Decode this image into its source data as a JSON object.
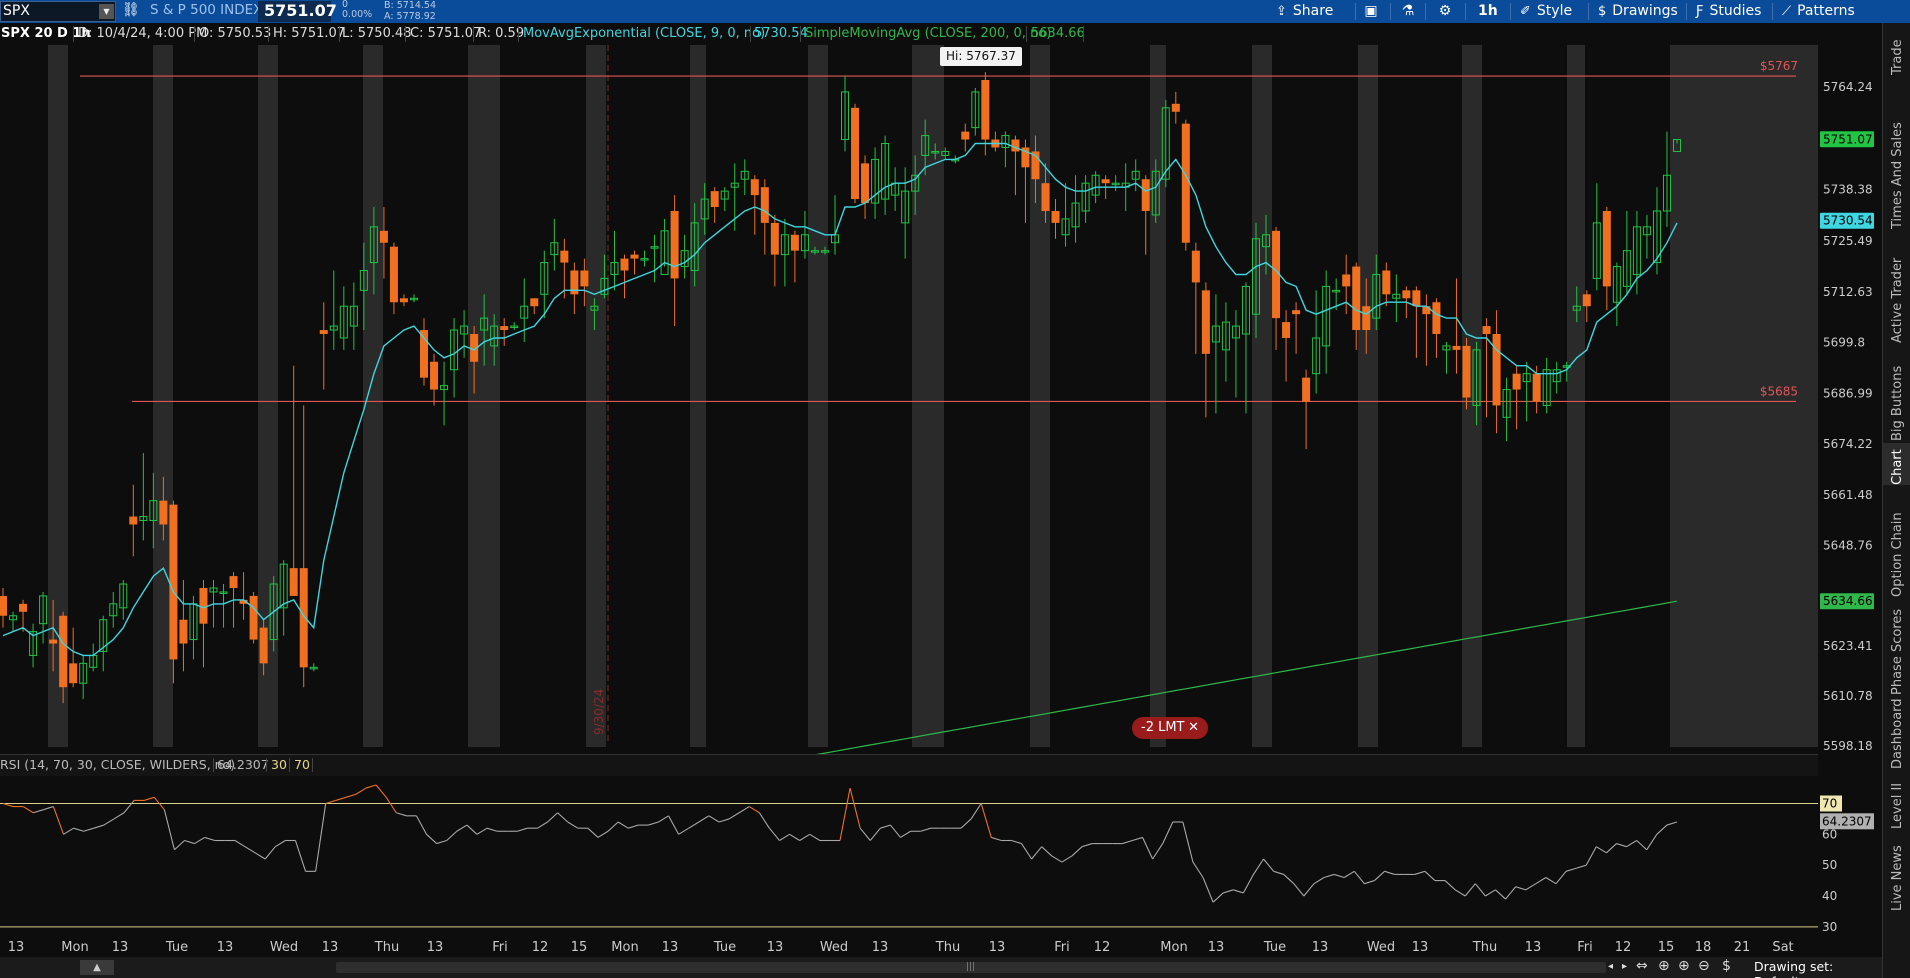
{
  "header": {
    "symbol": "SPX",
    "symbol_dropdown": "▼",
    "description": "S & P 500 INDEX",
    "last": "5751.07",
    "change": "0",
    "change_pct": "0.00%",
    "bid": "B: 5714.54",
    "ask": "A: 5778.92",
    "share": "Share",
    "timeframe": "1h",
    "style": "Style",
    "drawings": "Drawings",
    "studies": "Studies",
    "patterns": "Patterns"
  },
  "info": {
    "title": "SPX 20 D 1h",
    "date": "D: 10/4/24, 4:00 PM",
    "open": "O: 5750.53",
    "high": "H: 5751.07",
    "low": "L: 5750.48",
    "close": "C: 5751.07",
    "range": "R: 0.59",
    "ema_label": "MovAvgExponential (CLOSE, 9, 0, no)",
    "ema_value": "5730.54",
    "sma_label": "SimpleMovingAvg (CLOSE, 200, 0, no)",
    "sma_value": "5634.66"
  },
  "rsi": {
    "label": "RSI (14, 70, 30, CLOSE, WILDERS, no)",
    "value": "64.2307",
    "low": "30",
    "high": "70",
    "axis_ticks": [
      "70",
      "64.2307",
      "60",
      "50",
      "40",
      "30"
    ]
  },
  "price_axis": [
    "5764.24",
    "5751.07",
    "5738.38",
    "5730.54",
    "5725.49",
    "5712.63",
    "5699.8",
    "5686.99",
    "5674.22",
    "5661.48",
    "5648.76",
    "5634.66",
    "5623.41",
    "5610.78",
    "5598.18"
  ],
  "levels": [
    {
      "price": 5767,
      "label": "$5767"
    },
    {
      "price": 5685,
      "label": "$5685"
    }
  ],
  "hi_tooltip": "Hi: 5767.37",
  "date_marker": "9/30/24",
  "order": {
    "label": "-2 LMT",
    "close": "✕"
  },
  "time_axis": [
    "13",
    "Mon",
    "13",
    "Tue",
    "13",
    "Wed",
    "13",
    "Thu",
    "13",
    "Fri",
    "12",
    "15",
    "Mon",
    "13",
    "Tue",
    "13",
    "Wed",
    "13",
    "Thu",
    "13",
    "Fri",
    "12",
    "Mon",
    "13",
    "Tue",
    "13",
    "Wed",
    "13",
    "Thu",
    "13",
    "Fri",
    "12",
    "15",
    "18",
    "21",
    "Sat"
  ],
  "right_tabs": [
    "Trade",
    "Times And Sales",
    "Active Trader",
    "Big Buttons",
    "Chart",
    "Option Chain",
    "Phase Scores",
    "Dashboard",
    "Level II",
    "Live News"
  ],
  "footer": {
    "drawing_set": "Drawing set: Default",
    "collapse": "▲"
  },
  "colors": {
    "bg": "#0d0d0d",
    "shade": "#2a2a2a",
    "up": "#22c443",
    "down": "#f07020",
    "ema": "#3ed6e0",
    "sma": "#2fb74a",
    "level": "#e05555",
    "rsi_line": "#a8a8a8",
    "rsi_ob": "#f07020",
    "ob_line": "#d8d08a"
  },
  "chart_data": {
    "type": "candlestick",
    "symbol": "SPX",
    "interval": "1h",
    "ylim": [
      5598.18,
      5770
    ],
    "candles": [
      [
        5636,
        5631,
        5638,
        5628
      ],
      [
        5630,
        5631,
        5632,
        5627
      ],
      [
        5634,
        5632,
        5635,
        5627
      ],
      [
        5621,
        5627,
        5629,
        5618
      ],
      [
        5629,
        5636,
        5637,
        5624
      ],
      [
        5625,
        5624,
        5635,
        5617
      ],
      [
        5631,
        5613,
        5632,
        5609
      ],
      [
        5619,
        5614,
        5628,
        5613
      ],
      [
        5614,
        5619,
        5621,
        5610
      ],
      [
        5618,
        5621,
        5624,
        5617
      ],
      [
        5622,
        5630,
        5631,
        5617
      ],
      [
        5631,
        5634,
        5637,
        5628
      ],
      [
        5633,
        5639,
        5640,
        5630
      ],
      [
        5656,
        5654,
        5664,
        5646
      ],
      [
        5655,
        5656,
        5672,
        5650
      ],
      [
        5655,
        5660,
        5667,
        5648
      ],
      [
        5660,
        5654,
        5666,
        5650
      ],
      [
        5659,
        5620,
        5660,
        5614
      ],
      [
        5630,
        5624,
        5640,
        5617
      ],
      [
        5625,
        5634,
        5636,
        5620
      ],
      [
        5638,
        5629,
        5640,
        5618
      ],
      [
        5637,
        5638,
        5640,
        5628
      ],
      [
        5637,
        5637,
        5639,
        5628
      ],
      [
        5641,
        5638,
        5642,
        5628
      ],
      [
        5635,
        5634,
        5642,
        5630
      ],
      [
        5636,
        5625,
        5637,
        5624
      ],
      [
        5628,
        5619,
        5630,
        5616
      ],
      [
        5625,
        5639,
        5641,
        5622
      ],
      [
        5633,
        5644,
        5645,
        5626
      ],
      [
        5643,
        5636,
        5694,
        5636
      ],
      [
        5643,
        5618,
        5684,
        5613
      ],
      [
        5618,
        5618,
        5619,
        5617
      ],
      [
        5703,
        5702,
        5710,
        5688
      ],
      [
        5703,
        5704,
        5718,
        5698
      ],
      [
        5701,
        5709,
        5714,
        5698
      ],
      [
        5704,
        5709,
        5715,
        5698
      ],
      [
        5713,
        5718,
        5725,
        5703
      ],
      [
        5720,
        5729,
        5734,
        5712
      ],
      [
        5728,
        5725,
        5734,
        5716
      ],
      [
        5724,
        5710,
        5725,
        5707
      ],
      [
        5711,
        5710,
        5712,
        5709
      ],
      [
        5711,
        5711,
        5712,
        5710
      ],
      [
        5703,
        5691,
        5706,
        5689
      ],
      [
        5695,
        5688,
        5697,
        5684
      ],
      [
        5688,
        5689,
        5695,
        5679
      ],
      [
        5693,
        5703,
        5706,
        5686
      ],
      [
        5702,
        5704,
        5708,
        5696
      ],
      [
        5702,
        5695,
        5704,
        5687
      ],
      [
        5703,
        5706,
        5712,
        5694
      ],
      [
        5699,
        5704,
        5707,
        5694
      ],
      [
        5704,
        5703,
        5706,
        5699
      ],
      [
        5704,
        5704,
        5705,
        5703
      ],
      [
        5706,
        5709,
        5716,
        5700
      ],
      [
        5711,
        5709,
        5711,
        5707
      ],
      [
        5712,
        5720,
        5723,
        5706
      ],
      [
        5722,
        5725,
        5731,
        5718
      ],
      [
        5723,
        5720,
        5726,
        5711
      ],
      [
        5718,
        5712,
        5720,
        5707
      ],
      [
        5718,
        5714,
        5721,
        5709
      ],
      [
        5708,
        5709,
        5711,
        5703
      ],
      [
        5712,
        5716,
        5722,
        5711
      ],
      [
        5717,
        5720,
        5728,
        5713
      ],
      [
        5721,
        5718,
        5722,
        5711
      ],
      [
        5722,
        5721,
        5723,
        5717
      ],
      [
        5721,
        5721,
        5723,
        5719
      ],
      [
        5724,
        5724,
        5727,
        5715
      ],
      [
        5717,
        5728,
        5731,
        5719
      ],
      [
        5733,
        5716,
        5737,
        5704
      ],
      [
        5719,
        5723,
        5727,
        5716
      ],
      [
        5718,
        5730,
        5735,
        5714
      ],
      [
        5731,
        5736,
        5740,
        5727
      ],
      [
        5738,
        5734,
        5739,
        5730
      ],
      [
        5736,
        5738,
        5739,
        5733
      ],
      [
        5739,
        5740,
        5745,
        5728
      ],
      [
        5741,
        5743,
        5746,
        5737
      ],
      [
        5741,
        5737,
        5742,
        5727
      ],
      [
        5739,
        5730,
        5741,
        5722
      ],
      [
        5730,
        5722,
        5732,
        5714
      ],
      [
        5722,
        5727,
        5731,
        5714
      ],
      [
        5727,
        5723,
        5728,
        5715
      ],
      [
        5723,
        5727,
        5733,
        5721
      ],
      [
        5723,
        5723,
        5724,
        5722
      ],
      [
        5723,
        5723,
        5724,
        5722
      ],
      [
        5725,
        5727,
        5737,
        5722
      ],
      [
        5751,
        5763,
        5767,
        5748
      ],
      [
        5759,
        5736,
        5760,
        5735
      ],
      [
        5745,
        5735,
        5747,
        5731
      ],
      [
        5735,
        5746,
        5749,
        5731
      ],
      [
        5736,
        5750,
        5752,
        5732
      ],
      [
        5737,
        5740,
        5744,
        5733
      ],
      [
        5730,
        5738,
        5744,
        5721
      ],
      [
        5738,
        5742,
        5747,
        5732
      ],
      [
        5747,
        5752,
        5756,
        5742
      ],
      [
        5748,
        5748,
        5750,
        5746
      ],
      [
        5747,
        5748,
        5749,
        5746
      ],
      [
        5746,
        5746,
        5747,
        5745
      ],
      [
        5753,
        5751,
        5755,
        5748
      ],
      [
        5754,
        5763,
        5764,
        5752
      ],
      [
        5766,
        5751,
        5768,
        5747
      ],
      [
        5751,
        5749,
        5753,
        5748
      ],
      [
        5749,
        5752,
        5753,
        5744
      ],
      [
        5751,
        5748,
        5752,
        5737
      ],
      [
        5749,
        5744,
        5751,
        5730
      ],
      [
        5748,
        5741,
        5752,
        5735
      ],
      [
        5740,
        5733,
        5745,
        5730
      ],
      [
        5733,
        5730,
        5736,
        5726
      ],
      [
        5727,
        5731,
        5740,
        5724
      ],
      [
        5729,
        5735,
        5742,
        5725
      ],
      [
        5733,
        5740,
        5742,
        5730
      ],
      [
        5737,
        5742,
        5743,
        5735
      ],
      [
        5741,
        5740,
        5742,
        5736
      ],
      [
        5740,
        5740,
        5742,
        5738
      ],
      [
        5739,
        5740,
        5745,
        5733
      ],
      [
        5741,
        5743,
        5746,
        5738
      ],
      [
        5741,
        5733,
        5742,
        5722
      ],
      [
        5732,
        5743,
        5746,
        5730
      ],
      [
        5741,
        5759,
        5761,
        5739
      ],
      [
        5760,
        5758,
        5763,
        5755
      ],
      [
        5755,
        5725,
        5756,
        5723
      ],
      [
        5723,
        5715,
        5725,
        5697
      ],
      [
        5713,
        5697,
        5715,
        5681
      ],
      [
        5700,
        5704,
        5712,
        5682
      ],
      [
        5698,
        5705,
        5710,
        5690
      ],
      [
        5701,
        5704,
        5708,
        5686
      ],
      [
        5702,
        5714,
        5715,
        5682
      ],
      [
        5707,
        5726,
        5730,
        5701
      ],
      [
        5724,
        5727,
        5732,
        5717
      ],
      [
        5728,
        5706,
        5729,
        5698
      ],
      [
        5705,
        5701,
        5708,
        5690
      ],
      [
        5708,
        5707,
        5710,
        5697
      ],
      [
        5691,
        5685,
        5693,
        5673
      ],
      [
        5692,
        5701,
        5713,
        5687
      ],
      [
        5699,
        5714,
        5718,
        5692
      ],
      [
        5713,
        5713,
        5716,
        5708
      ],
      [
        5717,
        5714,
        5722,
        5707
      ],
      [
        5719,
        5703,
        5720,
        5698
      ],
      [
        5709,
        5703,
        5716,
        5697
      ],
      [
        5706,
        5717,
        5722,
        5703
      ],
      [
        5718,
        5712,
        5720,
        5709
      ],
      [
        5711,
        5712,
        5717,
        5705
      ],
      [
        5713,
        5711,
        5714,
        5706
      ],
      [
        5713,
        5709,
        5714,
        5696
      ],
      [
        5709,
        5707,
        5712,
        5694
      ],
      [
        5710,
        5702,
        5711,
        5696
      ],
      [
        5698,
        5699,
        5700,
        5692
      ],
      [
        5699,
        5698,
        5716,
        5692
      ],
      [
        5699,
        5686,
        5701,
        5683
      ],
      [
        5684,
        5698,
        5700,
        5679
      ],
      [
        5704,
        5702,
        5706,
        5681
      ],
      [
        5702,
        5684,
        5708,
        5677
      ],
      [
        5681,
        5688,
        5691,
        5675
      ],
      [
        5692,
        5688,
        5694,
        5678
      ],
      [
        5690,
        5692,
        5695,
        5680
      ],
      [
        5692,
        5685,
        5694,
        5682
      ],
      [
        5684,
        5693,
        5696,
        5682
      ],
      [
        5690,
        5693,
        5695,
        5687
      ],
      [
        5694,
        5694,
        5695,
        5690
      ],
      [
        5708,
        5709,
        5714,
        5705
      ],
      [
        5712,
        5709,
        5713,
        5705
      ],
      [
        5716,
        5730,
        5740,
        5713
      ],
      [
        5733,
        5714,
        5734,
        5708
      ],
      [
        5710,
        5719,
        5720,
        5704
      ],
      [
        5714,
        5723,
        5733,
        5712
      ],
      [
        5717,
        5729,
        5733,
        5712
      ],
      [
        5727,
        5729,
        5732,
        5721
      ],
      [
        5720,
        5733,
        5739,
        5717
      ],
      [
        5733,
        5742,
        5753,
        5729
      ],
      [
        5748,
        5751,
        5751,
        5750
      ]
    ],
    "ema_9": [
      5626,
      5627,
      5628,
      5626,
      5627,
      5628,
      5624,
      5622,
      5621,
      5621,
      5623,
      5625,
      5628,
      5633,
      5637,
      5641,
      5643,
      5637,
      5634,
      5634,
      5633,
      5634,
      5634,
      5635,
      5635,
      5633,
      5630,
      5632,
      5634,
      5635,
      5631,
      5628,
      5645,
      5656,
      5667,
      5675,
      5683,
      5692,
      5699,
      5701,
      5703,
      5704,
      5701,
      5698,
      5696,
      5697,
      5699,
      5698,
      5700,
      5701,
      5701,
      5702,
      5703,
      5704,
      5707,
      5711,
      5713,
      5713,
      5713,
      5712,
      5713,
      5714,
      5715,
      5716,
      5717,
      5718,
      5720,
      5719,
      5720,
      5722,
      5725,
      5727,
      5729,
      5731,
      5733,
      5734,
      5733,
      5731,
      5730,
      5729,
      5729,
      5728,
      5727,
      5727,
      5734,
      5734,
      5735,
      5737,
      5739,
      5740,
      5740,
      5741,
      5744,
      5745,
      5746,
      5746,
      5747,
      5750,
      5750,
      5750,
      5750,
      5749,
      5748,
      5747,
      5744,
      5741,
      5739,
      5738,
      5738,
      5739,
      5739,
      5739,
      5739,
      5740,
      5738,
      5739,
      5743,
      5746,
      5742,
      5737,
      5729,
      5724,
      5720,
      5717,
      5717,
      5719,
      5720,
      5718,
      5715,
      5714,
      5708,
      5707,
      5708,
      5709,
      5710,
      5708,
      5707,
      5709,
      5710,
      5710,
      5710,
      5709,
      5709,
      5707,
      5706,
      5706,
      5702,
      5701,
      5701,
      5698,
      5696,
      5694,
      5694,
      5692,
      5692,
      5692,
      5693,
      5696,
      5698,
      5705,
      5707,
      5709,
      5712,
      5716,
      5718,
      5721,
      5725,
      5730
    ],
    "sma_200_range": [
      5595.5,
      5634.66
    ],
    "rsi_14": [
      70,
      69,
      69,
      67,
      68,
      69,
      60,
      62,
      61,
      62,
      63,
      65,
      67,
      71,
      71,
      72,
      68,
      55,
      58,
      57,
      59,
      58,
      58,
      58,
      56,
      54,
      52,
      56,
      58,
      58,
      48,
      48,
      70,
      71,
      72,
      73,
      75,
      76,
      72,
      67,
      66,
      66,
      60,
      57,
      58,
      61,
      63,
      60,
      62,
      61,
      61,
      61,
      62,
      62,
      64,
      67,
      64,
      62,
      62,
      59,
      61,
      64,
      62,
      63,
      63,
      64,
      66,
      60,
      62,
      64,
      66,
      64,
      65,
      67,
      69,
      67,
      62,
      58,
      60,
      58,
      60,
      58,
      58,
      58,
      75,
      62,
      58,
      62,
      63,
      59,
      61,
      61,
      62,
      62,
      62,
      62,
      65,
      70,
      59,
      58,
      58,
      57,
      52,
      56,
      53,
      51,
      53,
      56,
      57,
      57,
      57,
      57,
      58,
      59,
      52,
      57,
      64,
      64,
      51,
      46,
      38,
      41,
      42,
      41,
      47,
      52,
      48,
      47,
      44,
      40,
      44,
      46,
      47,
      46,
      48,
      44,
      45,
      48,
      47,
      47,
      47,
      48,
      45,
      45,
      42,
      40,
      44,
      40,
      42,
      39,
      43,
      42,
      44,
      46,
      44,
      48,
      49,
      50,
      56,
      54,
      57,
      56,
      58,
      55,
      60,
      63,
      64
    ],
    "rsi_levels": [
      30,
      70
    ]
  }
}
